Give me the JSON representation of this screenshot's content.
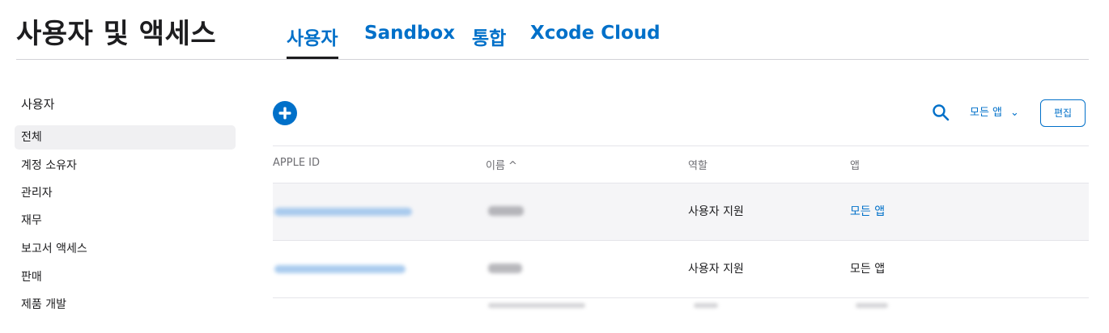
{
  "header": {
    "title": "사용자 및 액세스",
    "tabs": [
      {
        "label": "사용자",
        "active": true
      },
      {
        "label": "Sandbox",
        "active": false
      },
      {
        "label": "통합",
        "active": false
      },
      {
        "label": "Xcode Cloud",
        "active": false
      }
    ]
  },
  "sidebar": {
    "heading": "사용자",
    "items": [
      {
        "label": "전체",
        "selected": true
      },
      {
        "label": "계정 소유자",
        "selected": false
      },
      {
        "label": "관리자",
        "selected": false
      },
      {
        "label": "재무",
        "selected": false
      },
      {
        "label": "보고서 액세스",
        "selected": false
      },
      {
        "label": "판매",
        "selected": false
      },
      {
        "label": "제품 개발",
        "selected": false
      }
    ]
  },
  "toolbar": {
    "add_icon": "plus-circle-icon",
    "search_icon": "search-icon",
    "filter_label": "모든 앱",
    "filter_chevron": "⌄",
    "edit_label": "편집"
  },
  "table": {
    "columns": [
      {
        "label": "APPLE ID"
      },
      {
        "label": "이름 ^"
      },
      {
        "label": "역할"
      },
      {
        "label": "앱"
      }
    ],
    "rows": [
      {
        "apple_id_redacted": true,
        "name_redacted": true,
        "role": "사용자 지원",
        "apps": "모든 앱",
        "apps_is_link": true
      },
      {
        "apple_id_redacted": true,
        "name_redacted": true,
        "role": "사용자 지원",
        "apps": "모든 앱",
        "apps_is_link": false
      }
    ]
  },
  "colors": {
    "accent": "#0070c9",
    "text": "#1d1d1f",
    "muted": "#6e6e73",
    "row_highlight": "#f5f5f7",
    "selected_bg": "#f0f0f2"
  }
}
